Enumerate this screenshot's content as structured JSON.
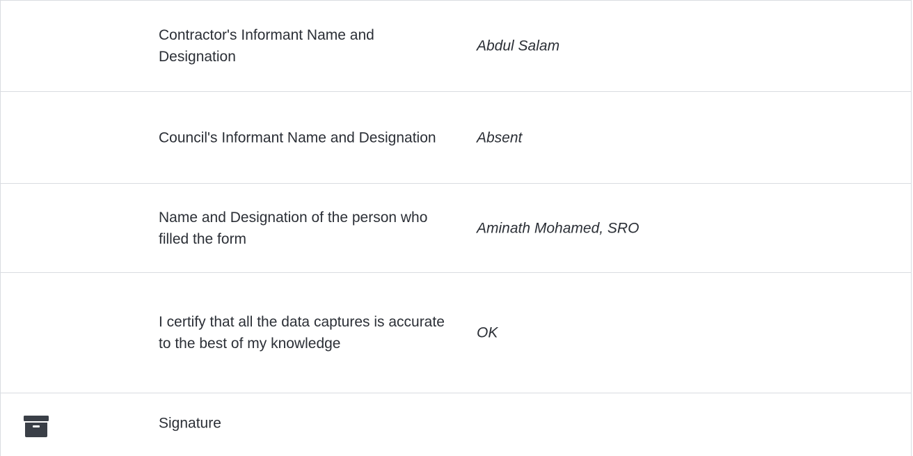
{
  "rows": [
    {
      "label": "Contractor's Informant Name and Designation",
      "value": "Abdul Salam"
    },
    {
      "label": "Council's Informant Name and Designation",
      "value": "Absent"
    },
    {
      "label": "Name and Designation of the person who filled the form",
      "value": "Aminath Mohamed, SRO"
    },
    {
      "label": "I certify that all the data captures is accurate to the best of my knowledge",
      "value": "OK"
    },
    {
      "label": "Signature",
      "icon": "archive-icon"
    }
  ]
}
